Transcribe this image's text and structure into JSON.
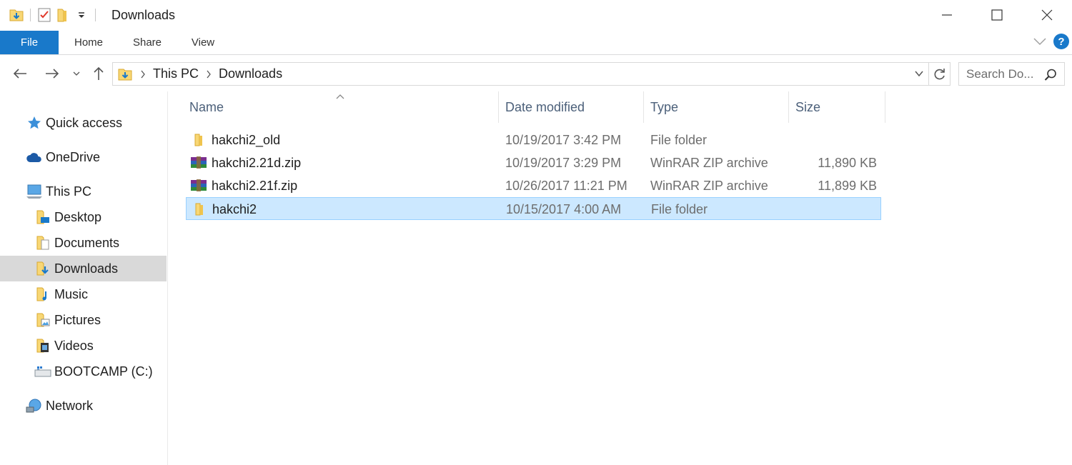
{
  "window": {
    "title": "Downloads"
  },
  "ribbon": {
    "tabs": [
      {
        "label": "File"
      },
      {
        "label": "Home"
      },
      {
        "label": "Share"
      },
      {
        "label": "View"
      }
    ],
    "help_label": "?"
  },
  "address": {
    "crumbs": [
      "This PC",
      "Downloads"
    ]
  },
  "search": {
    "placeholder": "Search Do..."
  },
  "nav": {
    "items": [
      {
        "label": "Quick access",
        "icon": "star-icon"
      },
      {
        "label": "OneDrive",
        "icon": "cloud-icon"
      },
      {
        "label": "This PC",
        "icon": "computer-icon"
      },
      {
        "label": "Desktop",
        "icon": "desktop-folder-icon"
      },
      {
        "label": "Documents",
        "icon": "documents-folder-icon"
      },
      {
        "label": "Downloads",
        "icon": "downloads-folder-icon"
      },
      {
        "label": "Music",
        "icon": "music-folder-icon"
      },
      {
        "label": "Pictures",
        "icon": "pictures-folder-icon"
      },
      {
        "label": "Videos",
        "icon": "videos-folder-icon"
      },
      {
        "label": "BOOTCAMP (C:)",
        "icon": "drive-icon"
      },
      {
        "label": "Network",
        "icon": "network-icon"
      }
    ],
    "selected": "Downloads"
  },
  "columns": {
    "name": "Name",
    "date": "Date modified",
    "type": "Type",
    "size": "Size"
  },
  "files": [
    {
      "name": "hakchi2_old",
      "date": "10/19/2017 3:42 PM",
      "type": "File folder",
      "size": "",
      "icon": "folder-icon"
    },
    {
      "name": "hakchi2.21d.zip",
      "date": "10/19/2017 3:29 PM",
      "type": "WinRAR ZIP archive",
      "size": "11,890 KB",
      "icon": "winrar-archive-icon"
    },
    {
      "name": "hakchi2.21f.zip",
      "date": "10/26/2017 11:21 PM",
      "type": "WinRAR ZIP archive",
      "size": "11,899 KB",
      "icon": "winrar-archive-icon"
    },
    {
      "name": "hakchi2",
      "date": "10/15/2017 4:00 AM",
      "type": "File folder",
      "size": "",
      "icon": "folder-icon",
      "selected": true
    }
  ],
  "colors": {
    "accent": "#1979ca",
    "selection": "#cce8ff",
    "selection_border": "#99d1ff",
    "nav_selected": "#d9d9d9",
    "header_text": "#4c607a",
    "folder": "#f8d775"
  }
}
